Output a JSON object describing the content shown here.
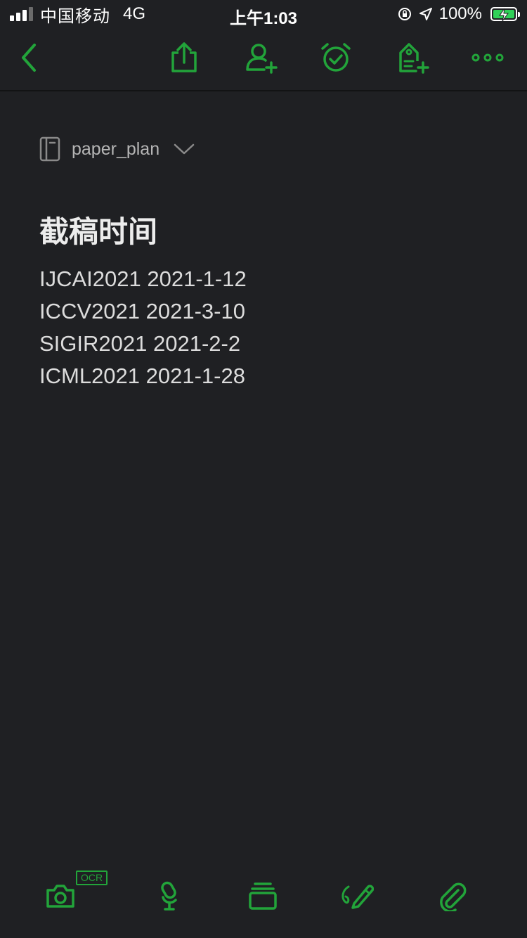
{
  "status_bar": {
    "carrier": "中国移动",
    "network": "4G",
    "time": "上午1:03",
    "battery": "100%"
  },
  "toolbar": {
    "icons": [
      "back-icon",
      "share-icon",
      "add-collaborator-icon",
      "reminder-icon",
      "tag-icon",
      "more-icon"
    ]
  },
  "notebook": {
    "name": "paper_plan"
  },
  "note": {
    "title": "截稿时间",
    "lines": [
      "IJCAI2021 2021-1-12",
      "ICCV2021 2021-3-10",
      "SIGIR2021 2021-2-2",
      "ICML2021 2021-1-28"
    ]
  },
  "bottom_bar": {
    "ocr_label": "OCR",
    "icons": [
      "camera-icon",
      "microphone-icon",
      "templates-icon",
      "handwriting-icon",
      "attachment-icon"
    ]
  },
  "colors": {
    "background": "#1f2023",
    "accent": "#22a43a",
    "text": "#dcdcdc",
    "muted": "#b5b5b5"
  }
}
